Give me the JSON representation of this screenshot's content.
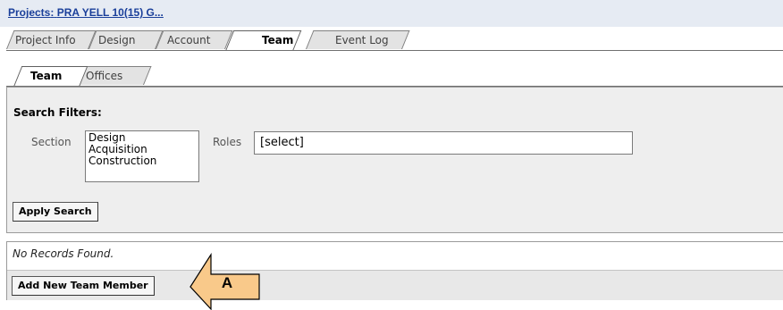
{
  "breadcrumb": {
    "label": "Projects",
    "separator": ":",
    "value": "PRA YELL 10(15) G..."
  },
  "main_tabs": [
    {
      "label": "Project Info",
      "active": false
    },
    {
      "label": "Design",
      "active": false
    },
    {
      "label": "Account",
      "active": false
    },
    {
      "label": "Team",
      "active": true
    },
    {
      "label": "Event Log",
      "active": false
    }
  ],
  "sub_tabs": [
    {
      "label": "Team",
      "active": true
    },
    {
      "label": "Offices",
      "active": false
    }
  ],
  "filters": {
    "title": "Search Filters:",
    "section_label": "Section",
    "section_options": [
      "Design",
      "Acquisition",
      "Construction"
    ],
    "roles_label": "Roles",
    "roles_value": "[select]",
    "apply_label": "Apply Search"
  },
  "records": {
    "empty_message": "No Records Found.",
    "add_label": "Add New Team Member"
  },
  "callout": {
    "label": "A",
    "color": "#f9c98a"
  }
}
